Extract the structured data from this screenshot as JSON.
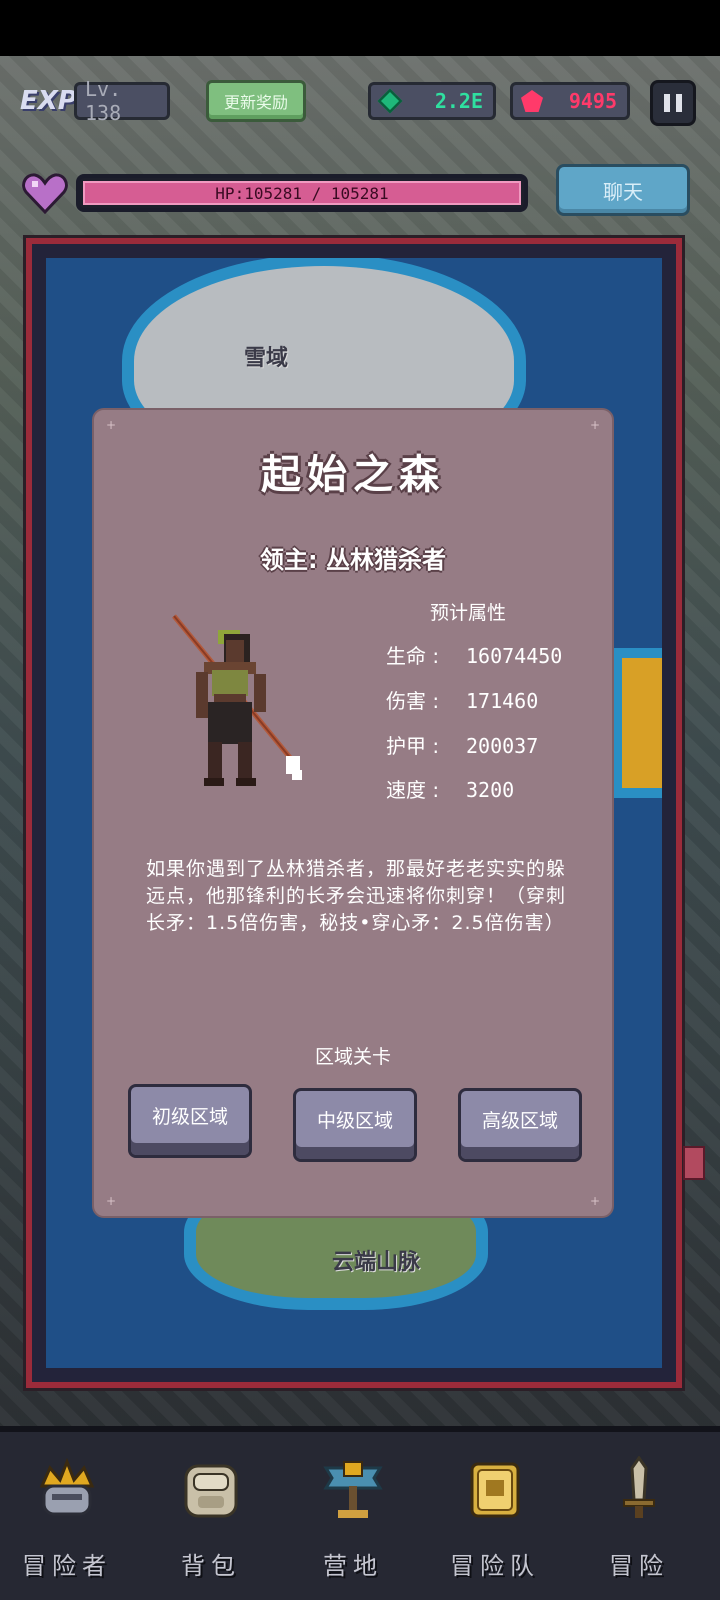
{
  "hud": {
    "exp_logo": "EXP",
    "level": "Lv. 138",
    "reward_button": "更新奖励",
    "gems": "2.2E",
    "rubies": "9495",
    "hp_text": "HP:105281 / 105281",
    "hp_fraction": 1.0,
    "chat_button": "聊天"
  },
  "map": {
    "regions": [
      {
        "name": "雪域"
      },
      {
        "name": "云端山脉"
      }
    ]
  },
  "dialog": {
    "title": "起始之森",
    "boss": "领主: 丛林猎杀者",
    "stats_title": "预计属性",
    "stats": [
      {
        "label": "生命 :",
        "value": "16074450"
      },
      {
        "label": "伤害 :",
        "value": "171460"
      },
      {
        "label": "护甲 :",
        "value": "200037"
      },
      {
        "label": "速度 :",
        "value": "3200"
      }
    ],
    "description": "如果你遇到了丛林猎杀者，那最好老老实实的躲远点，他那锋利的长矛会迅速将你刺穿！（穿刺长矛：1.5倍伤害，秘技•穿心矛：2.5倍伤害）",
    "zones_title": "区域关卡",
    "zones": [
      "初级区域",
      "中级区域",
      "高级区域"
    ]
  },
  "nav": [
    {
      "label": "冒险者",
      "icon": "crown-helmet-icon"
    },
    {
      "label": "背包",
      "icon": "backpack-icon"
    },
    {
      "label": "营地",
      "icon": "camp-banner-icon"
    },
    {
      "label": "冒险队",
      "icon": "team-book-icon"
    },
    {
      "label": "冒险",
      "icon": "sword-icon"
    }
  ],
  "colors": {
    "hp": "#d65d93",
    "gem": "#2fe0a0",
    "ruby": "#ff3a6a",
    "frame": "#9b2b3a",
    "dialog": "#967c85"
  }
}
